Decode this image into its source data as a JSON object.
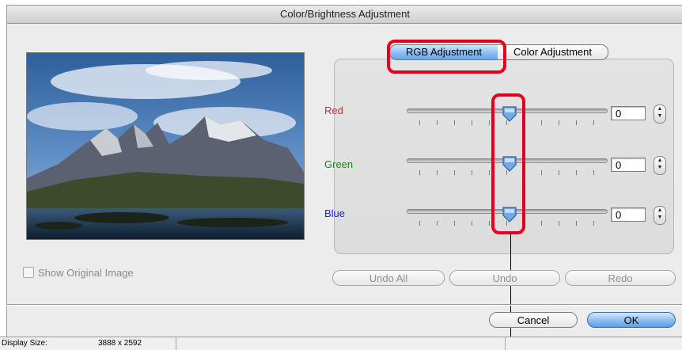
{
  "window": {
    "title": "Color/Brightness Adjustment"
  },
  "tabs": [
    {
      "label": "RGB Adjustment",
      "selected": true
    },
    {
      "label": "Color Adjustment",
      "selected": false
    }
  ],
  "sliders": [
    {
      "label": "Red",
      "value": "0",
      "color": "#c03030",
      "level": 0.5
    },
    {
      "label": "Green",
      "value": "0",
      "color": "#1d8a1d",
      "level": 0.5
    },
    {
      "label": "Blue",
      "value": "0",
      "color": "#2020d0",
      "level": 0.5
    }
  ],
  "show_original": {
    "label": "Show Original Image",
    "checked": false,
    "enabled": false
  },
  "history_buttons": {
    "undo_all": "Undo All",
    "undo": "Undo",
    "redo": "Redo"
  },
  "dialog_buttons": {
    "cancel": "Cancel",
    "ok": "OK"
  },
  "status": {
    "display_size_label": "Display Size:",
    "display_size_value": "3888 x 2592"
  },
  "colors": {
    "highlight": "#e4001c",
    "accent": "#6aa7e6"
  },
  "icons": {
    "stepper": "stepper-icon",
    "thumb": "slider-thumb-icon"
  }
}
